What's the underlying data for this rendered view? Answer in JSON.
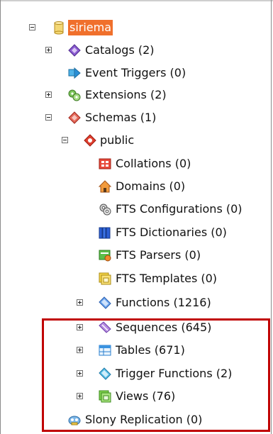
{
  "tree": {
    "server": {
      "label": "siriema",
      "icon": "database-icon"
    },
    "nodes": [
      {
        "label": "Catalogs (2)",
        "icon": "catalogs-icon",
        "expander": "plus"
      },
      {
        "label": "Event Triggers (0)",
        "icon": "event-triggers-icon",
        "expander": "none"
      },
      {
        "label": "Extensions (2)",
        "icon": "extensions-icon",
        "expander": "plus"
      },
      {
        "label": "Schemas (1)",
        "icon": "schemas-icon",
        "expander": "minus"
      },
      {
        "label": "public",
        "icon": "schema-public-icon",
        "expander": "minus"
      },
      {
        "label": "Collations (0)",
        "icon": "collations-icon",
        "expander": "none"
      },
      {
        "label": "Domains (0)",
        "icon": "domains-icon",
        "expander": "none"
      },
      {
        "label": "FTS Configurations (0)",
        "icon": "fts-configurations-icon",
        "expander": "none"
      },
      {
        "label": "FTS Dictionaries (0)",
        "icon": "fts-dictionaries-icon",
        "expander": "none"
      },
      {
        "label": "FTS Parsers (0)",
        "icon": "fts-parsers-icon",
        "expander": "none"
      },
      {
        "label": "FTS Templates (0)",
        "icon": "fts-templates-icon",
        "expander": "none"
      },
      {
        "label": "Functions (1216)",
        "icon": "functions-icon",
        "expander": "plus"
      },
      {
        "label": "Sequences (645)",
        "icon": "sequences-icon",
        "expander": "plus"
      },
      {
        "label": "Tables (671)",
        "icon": "tables-icon",
        "expander": "plus"
      },
      {
        "label": "Trigger Functions (2)",
        "icon": "trigger-functions-icon",
        "expander": "plus"
      },
      {
        "label": "Views (76)",
        "icon": "views-icon",
        "expander": "plus"
      },
      {
        "label": "Slony Replication (0)",
        "icon": "slony-replication-icon",
        "expander": "none"
      }
    ]
  },
  "colors": {
    "selection": "#f0702c",
    "highlight_border": "#c00000"
  }
}
